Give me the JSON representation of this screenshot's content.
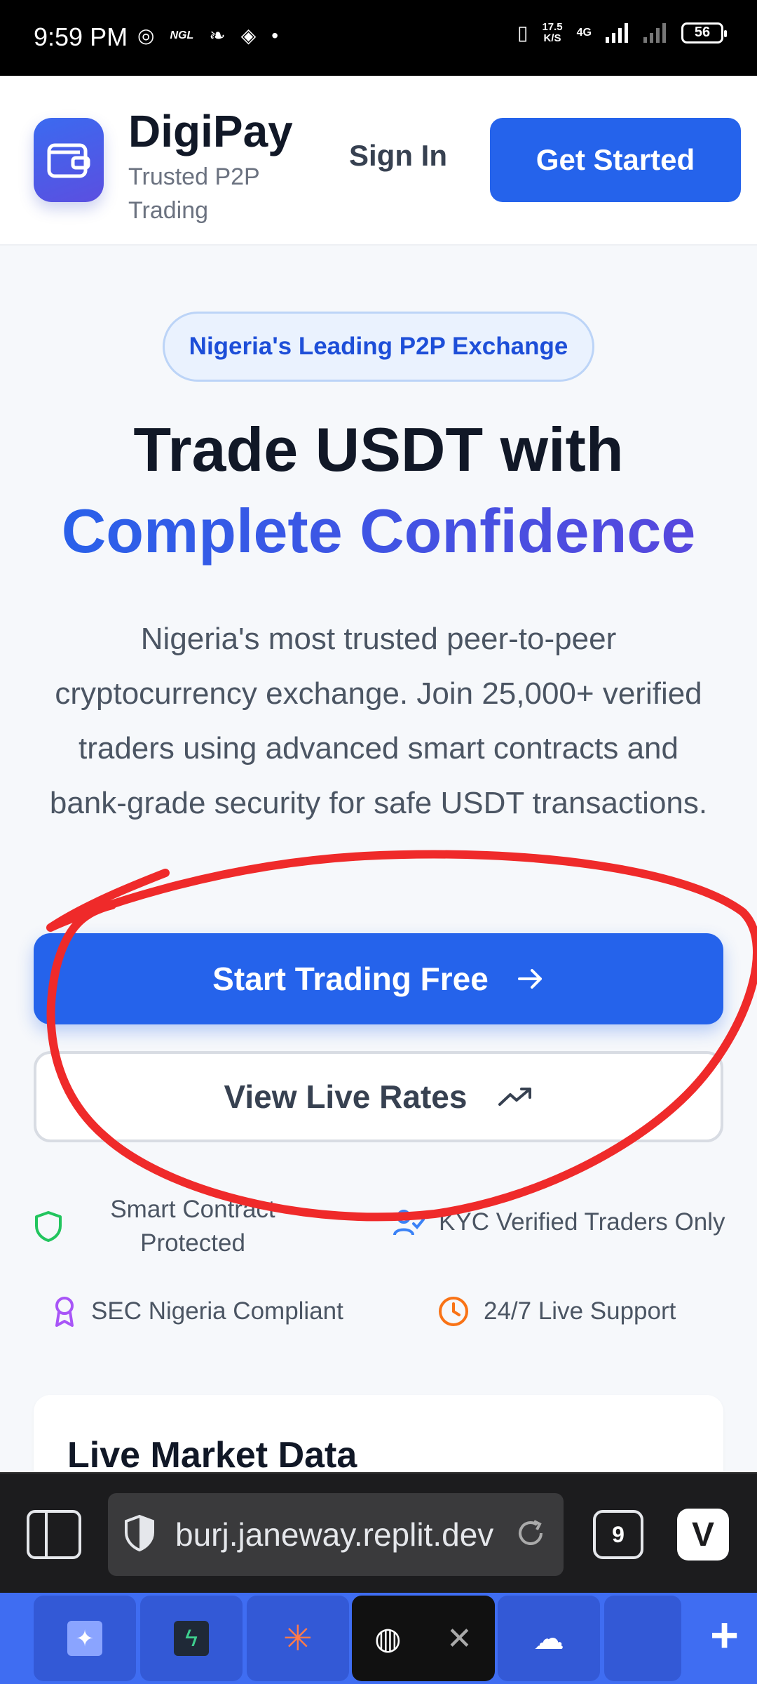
{
  "status_bar": {
    "time": "9:59 PM",
    "ngl": "NGL",
    "speed_top": "17.5",
    "speed_bottom": "K/S",
    "network": "4G",
    "battery": "56"
  },
  "header": {
    "brand_name": "DigiPay",
    "brand_subtitle": "Trusted P2P Trading",
    "sign_in_label": "Sign In",
    "get_started_label": "Get Started"
  },
  "hero": {
    "badge": "Nigeria's Leading P2P Exchange",
    "title_line1": "Trade USDT with",
    "title_line2": "Complete Confidence",
    "description": "Nigeria's most trusted peer-to-peer cryptocurrency exchange. Join 25,000+ verified traders using advanced smart contracts and bank-grade security for safe USDT transactions.",
    "primary_cta": "Start Trading Free",
    "secondary_cta": "View Live Rates"
  },
  "features": [
    {
      "label": "Smart Contract Protected",
      "icon": "shield-icon",
      "color": "#22c55e"
    },
    {
      "label": "KYC Verified Traders Only",
      "icon": "users-icon",
      "color": "#3b82f6"
    },
    {
      "label": "SEC Nigeria Compliant",
      "icon": "award-icon",
      "color": "#a855f7"
    },
    {
      "label": "24/7 Live Support",
      "icon": "clock-icon",
      "color": "#f97316"
    }
  ],
  "market": {
    "title": "Live Market Data"
  },
  "browser": {
    "url": "burj.janeway.replit.dev",
    "tab_count": "9"
  },
  "colors": {
    "accent": "#2563eb",
    "annotation": "#ef2a2a"
  }
}
